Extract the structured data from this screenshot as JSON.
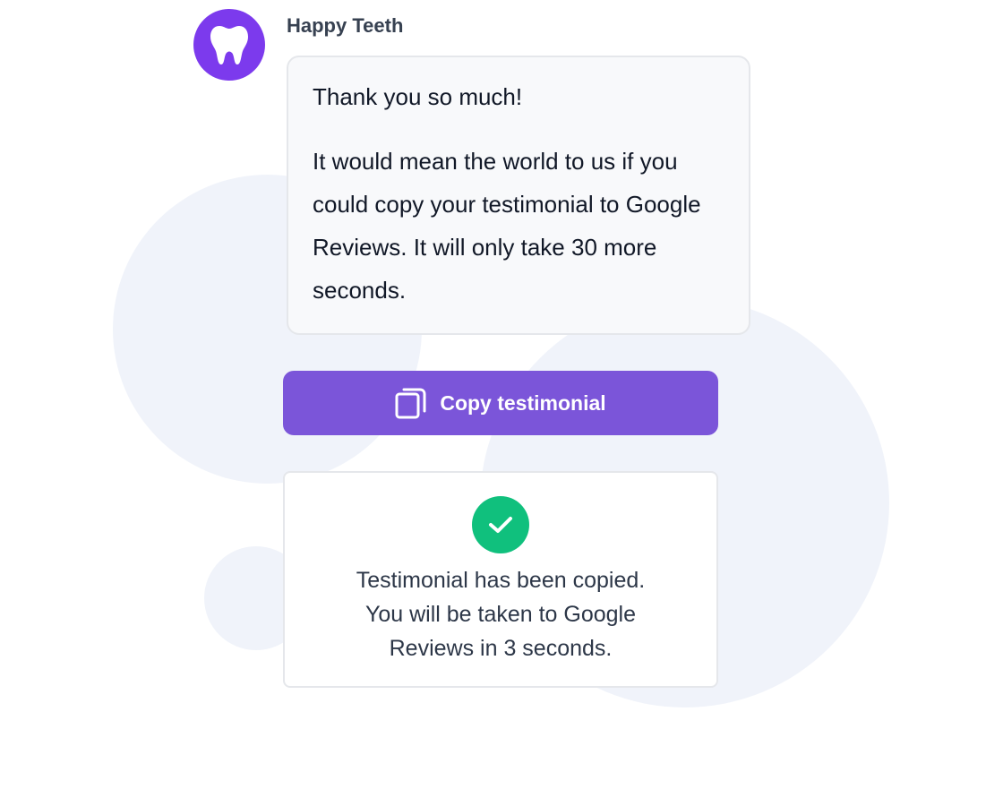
{
  "sender": {
    "name": "Happy Teeth",
    "avatar_icon": "tooth-icon",
    "avatar_color": "#7c3aed"
  },
  "message": {
    "greeting": "Thank you so much!",
    "body": "It would mean the world to us if you could copy your testimonial to Google Reviews. It will only take 30 more seconds."
  },
  "copy_button": {
    "label": "Copy testimonial",
    "icon": "copy-icon",
    "color": "#7b55d9"
  },
  "notice": {
    "icon": "check-icon",
    "icon_color": "#10c07d",
    "line1": "Testimonial has been copied.",
    "line2": "You will be taken to Google",
    "line3": "Reviews in 3 seconds."
  }
}
